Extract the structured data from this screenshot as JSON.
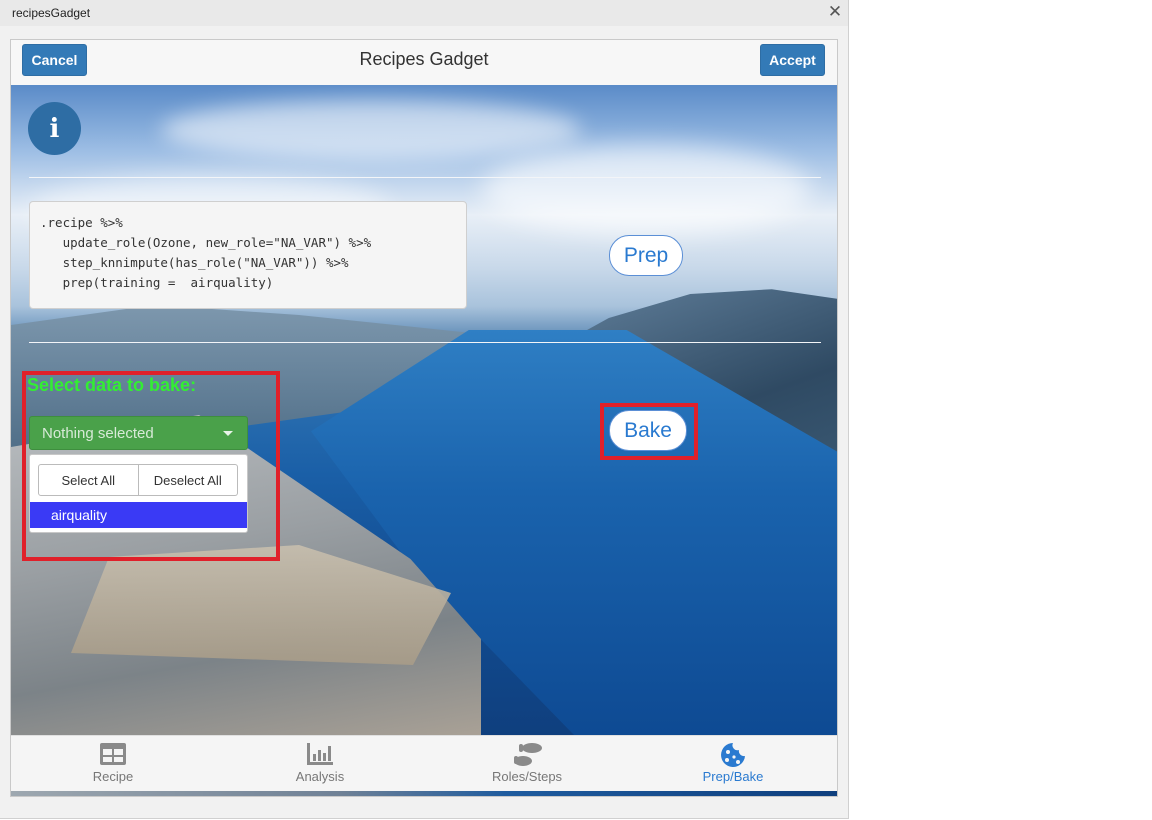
{
  "window": {
    "title": "recipesGadget",
    "close_glyph": "✕"
  },
  "header": {
    "cancel_label": "Cancel",
    "title": "Recipes Gadget",
    "accept_label": "Accept"
  },
  "info": {
    "glyph": "i"
  },
  "code": {
    "lines": [
      ".recipe %>%",
      "   update_role(Ozone, new_role=\"NA_VAR\") %>%",
      "   step_knnimpute(has_role(\"NA_VAR\")) %>%",
      "   prep(training =  airquality)"
    ]
  },
  "prep_button": {
    "label": "Prep"
  },
  "bake_button": {
    "label": "Bake"
  },
  "bake_select": {
    "label": "Select data to bake:",
    "placeholder": "Nothing selected",
    "select_all": "Select All",
    "deselect_all": "Deselect All",
    "options": [
      "airquality"
    ]
  },
  "tabs": [
    {
      "label": "Recipe",
      "icon": "table-icon"
    },
    {
      "label": "Analysis",
      "icon": "bar-chart-icon"
    },
    {
      "label": "Roles/Steps",
      "icon": "footsteps-icon"
    },
    {
      "label": "Prep/Bake",
      "icon": "cookie-icon"
    }
  ],
  "active_tab": "Prep/Bake",
  "colors": {
    "accent_blue": "#337ab7",
    "highlight_red": "#e0202a",
    "label_green": "#33ee33",
    "dropdown_green": "#4aa14a",
    "option_blue": "#3a3af5",
    "active_tab": "#2a7ad0"
  }
}
